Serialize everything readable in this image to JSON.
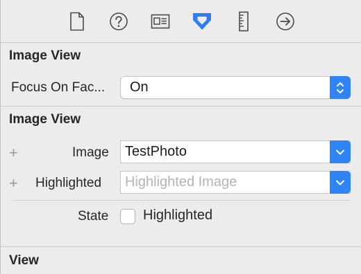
{
  "toolbar": {
    "icons": [
      {
        "name": "file-inspector-icon"
      },
      {
        "name": "quick-help-icon"
      },
      {
        "name": "identity-inspector-icon"
      },
      {
        "name": "attributes-inspector-icon",
        "selected": true,
        "color": "#2f7cf6"
      },
      {
        "name": "size-inspector-icon"
      },
      {
        "name": "connections-inspector-icon"
      }
    ]
  },
  "section1": {
    "title": "Image View",
    "focus_label": "Focus On Fac...",
    "focus_value": "On"
  },
  "section2": {
    "title": "Image View",
    "image_label": "Image",
    "image_value": "TestPhoto",
    "highlighted_label": "Highlighted",
    "highlighted_placeholder": "Highlighted Image",
    "state_label": "State",
    "state_checkbox_label": "Highlighted",
    "state_checked": false
  },
  "section3": {
    "title": "View"
  },
  "colors": {
    "accent": "#2f83f5",
    "background": "#ececec"
  }
}
